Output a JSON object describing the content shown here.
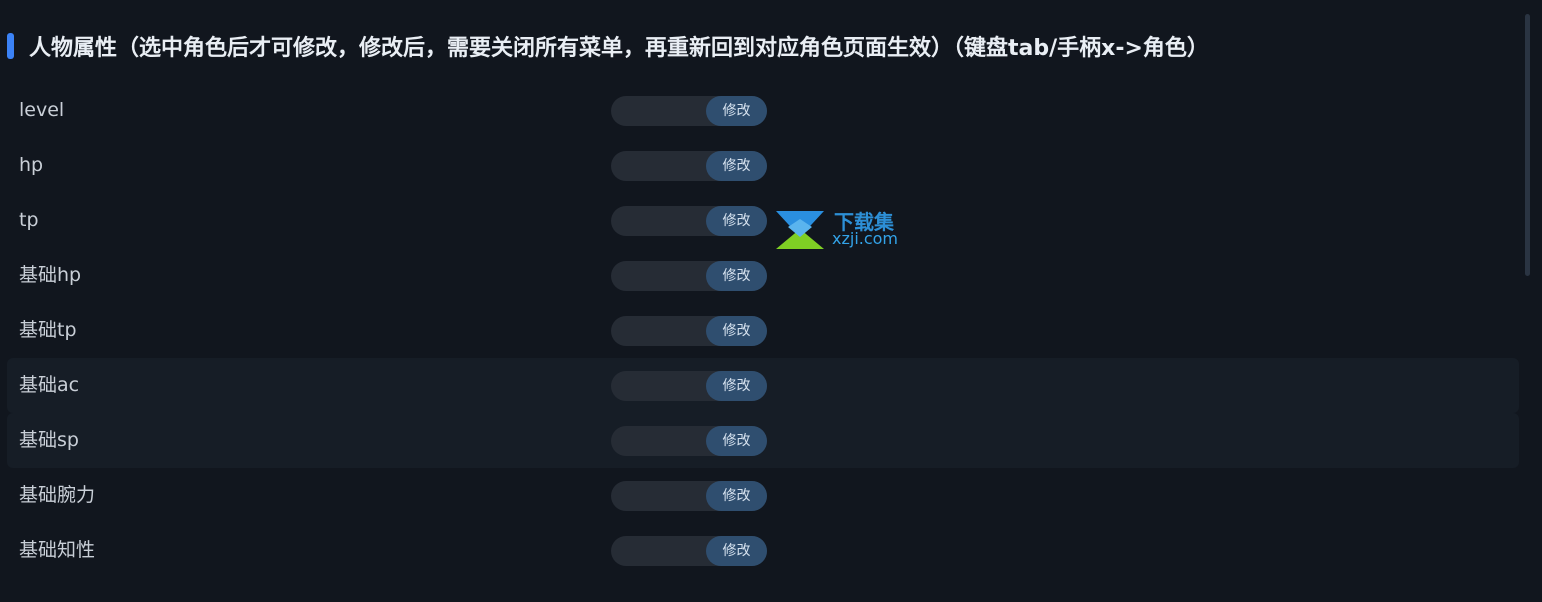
{
  "section": {
    "title": "人物属性（选中角色后才可修改，修改后，需要关闭所有菜单，再重新回到对应角色页面生效）（键盘tab/手柄x->角色）"
  },
  "modify_label": "修改",
  "rows": [
    {
      "label": "level",
      "value": "",
      "highlighted": false
    },
    {
      "label": "hp",
      "value": "",
      "highlighted": false
    },
    {
      "label": "tp",
      "value": "",
      "highlighted": false
    },
    {
      "label": "基础hp",
      "value": "",
      "highlighted": false
    },
    {
      "label": "基础tp",
      "value": "",
      "highlighted": false
    },
    {
      "label": "基础ac",
      "value": "",
      "highlighted": true
    },
    {
      "label": "基础sp",
      "value": "",
      "highlighted": true
    },
    {
      "label": "基础腕力",
      "value": "",
      "highlighted": false
    },
    {
      "label": "基础知性",
      "value": "",
      "highlighted": false
    }
  ],
  "watermark": {
    "logo_icon": "download-arrow-logo-icon",
    "name": "下载集",
    "domain": "xzji.com"
  },
  "colors": {
    "background": "#11161e",
    "accent": "#3b82f6",
    "input_bg": "#262c35",
    "button_bg": "#2f4e6f",
    "row_highlight": "#161d26"
  }
}
